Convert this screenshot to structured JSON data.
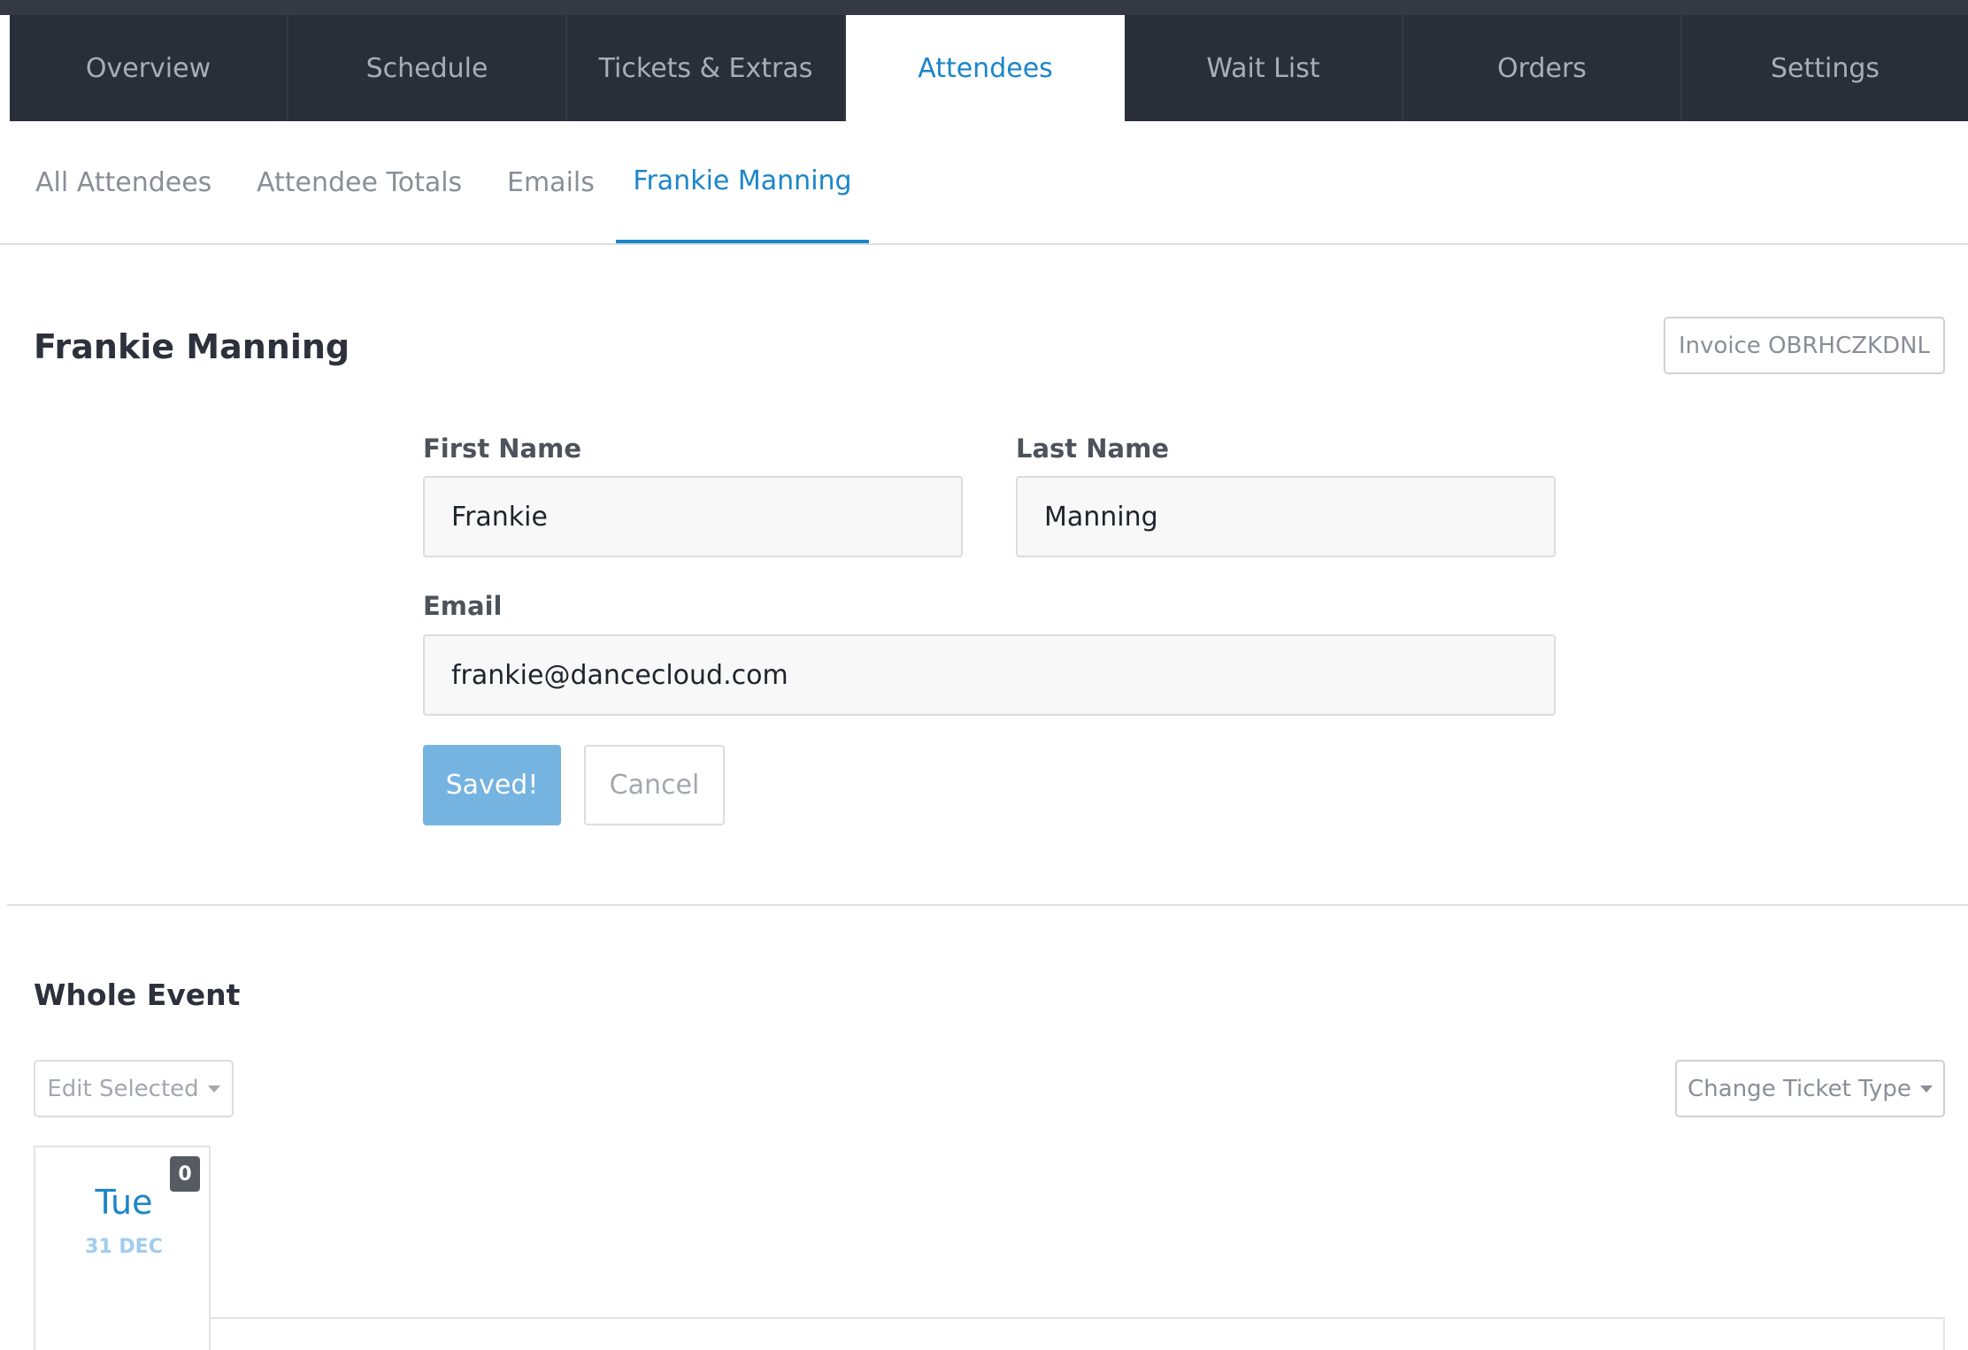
{
  "top_tabs": [
    {
      "label": "Overview"
    },
    {
      "label": "Schedule"
    },
    {
      "label": "Tickets & Extras"
    },
    {
      "label": "Attendees"
    },
    {
      "label": "Wait List"
    },
    {
      "label": "Orders"
    },
    {
      "label": "Settings"
    }
  ],
  "active_top_tab": "Attendees",
  "sub_tabs": [
    {
      "label": "All Attendees"
    },
    {
      "label": "Attendee Totals"
    },
    {
      "label": "Emails"
    },
    {
      "label": "Frankie Manning"
    }
  ],
  "active_sub_tab": "Frankie Manning",
  "attendee": {
    "title": "Frankie Manning",
    "invoice_button": "Invoice OBRHCZKDNL"
  },
  "form": {
    "first_name_label": "First Name",
    "first_name_value": "Frankie",
    "last_name_label": "Last Name",
    "last_name_value": "Manning",
    "email_label": "Email",
    "email_value": "frankie@dancecloud.com",
    "saved_button": "Saved!",
    "cancel_button": "Cancel"
  },
  "whole_event": {
    "title": "Whole Event",
    "edit_selected": "Edit Selected",
    "change_ticket_type": "Change Ticket Type",
    "day": {
      "badge": "0",
      "weekday": "Tue",
      "date": "31 DEC"
    }
  },
  "colors": {
    "nav_bg": "#292e39",
    "accent": "#1b85c9",
    "saved_bg": "#75b3e1",
    "badge_bg": "#555a63"
  }
}
